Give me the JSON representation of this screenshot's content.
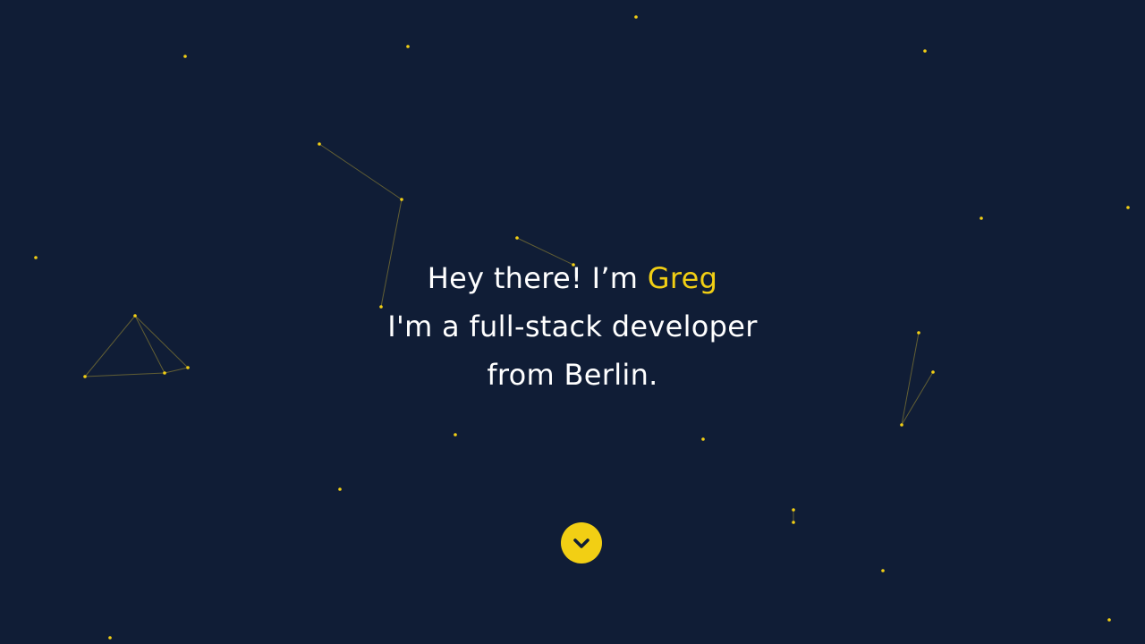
{
  "hero": {
    "greeting_prefix": "Hey there! I’m",
    "name": "Greg",
    "line2": "I'm a full-stack developer",
    "line3": "from Berlin."
  },
  "scroll_button": {
    "icon": "chevron-down-icon"
  },
  "colors": {
    "background": "#101d36",
    "accent": "#f2cf14",
    "text": "#ffffff",
    "link_line": "#7d7434"
  }
}
